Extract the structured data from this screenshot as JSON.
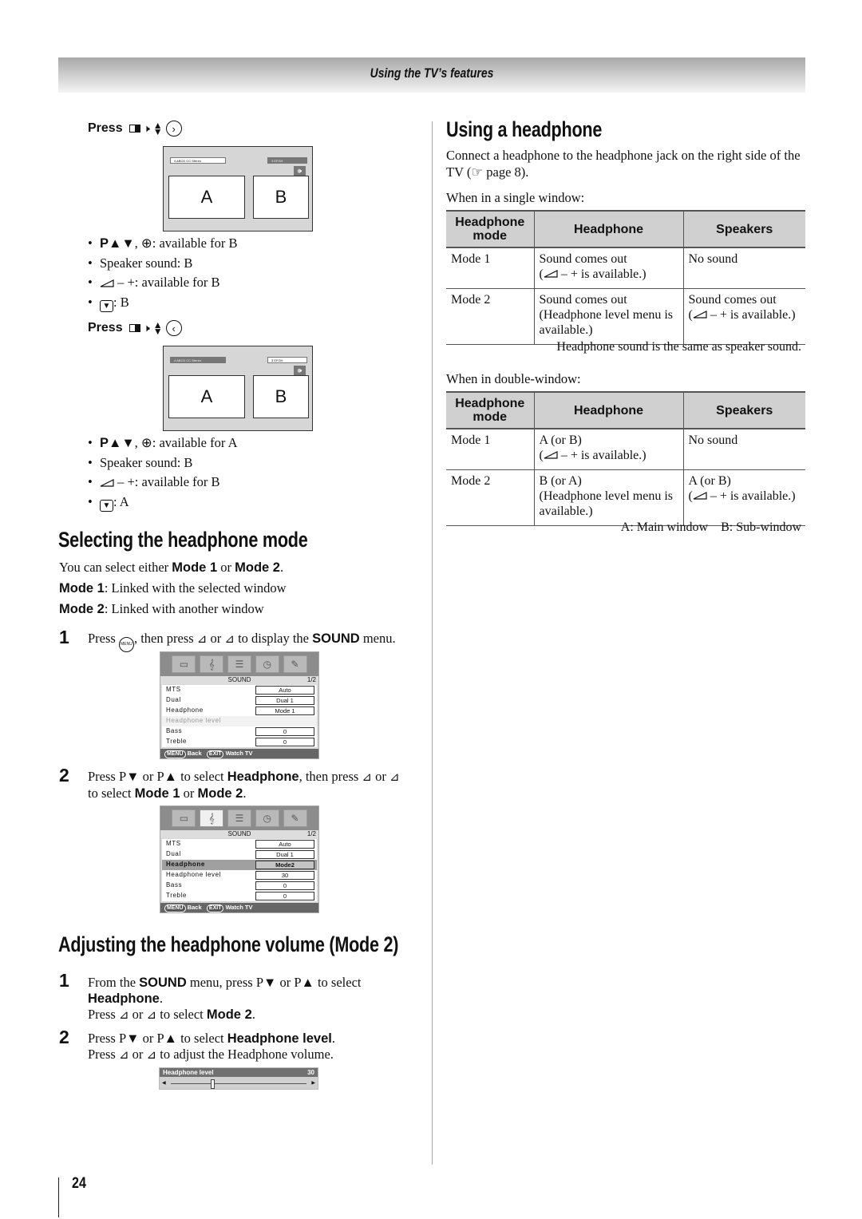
{
  "header": {
    "title": "Using the TV’s features"
  },
  "page_number": "24",
  "left": {
    "press_blocks": [
      {
        "label": "Press",
        "icons": [
          "split-window-icon",
          "speaker-icon",
          "up-down-icon",
          "right-arrow-circle-icon"
        ],
        "arrow_glyph": "›",
        "pip": {
          "main_label": "A",
          "sub_label": "B",
          "main_bar": "4  ABCD   CC Stereo",
          "sub_bar": "3  EFGH",
          "active": "sub"
        },
        "bullets": [
          {
            "bold": "P▲▼",
            "text": ", ⊕: available for B"
          },
          {
            "bold": "",
            "text": "Speaker sound: B"
          },
          {
            "bold": "",
            "text": " – +: available for B"
          },
          {
            "bold": "",
            "text": ": B"
          }
        ]
      },
      {
        "label": "Press",
        "icons": [
          "split-window-icon",
          "speaker-icon",
          "up-down-icon",
          "left-arrow-circle-icon"
        ],
        "arrow_glyph": "‹",
        "pip": {
          "main_label": "A",
          "sub_label": "B",
          "main_bar": "4  ABCD   CC Stereo",
          "sub_bar": "3  EFGH",
          "active": "main"
        },
        "bullets": [
          {
            "bold": "P▲▼",
            "text": ", ⊕: available for A"
          },
          {
            "bold": "",
            "text": "Speaker sound: B"
          },
          {
            "bold": "",
            "text": " – +: available for B"
          },
          {
            "bold": "",
            "text": ": A"
          }
        ]
      }
    ],
    "select_mode": {
      "heading": "Selecting the headphone mode",
      "intro_pre": "You can select either ",
      "intro_b1": "Mode 1",
      "intro_mid": " or ",
      "intro_b2": "Mode 2",
      "intro_post": ".",
      "mode1_label": "Mode 1",
      "mode1_text": ": Linked with the selected window",
      "mode2_label": "Mode 2",
      "mode2_text": ": Linked with another window",
      "steps": [
        {
          "num": "1",
          "pre": "Press ",
          "menu_btn": "MENU",
          "mid": ", then press ",
          "or": " or ",
          "post": " to display the ",
          "bold": "SOUND",
          "end": " menu."
        },
        {
          "num": "2",
          "pre": "Press P▼ or P▲ to select ",
          "bold1": "Headphone",
          "mid": ", then press ",
          "or": " or ",
          "line2_pre": "to select ",
          "bold2": "Mode 1",
          "line2_mid": " or ",
          "bold3": "Mode 2",
          "end": "."
        }
      ],
      "osd1": {
        "title": "SOUND",
        "page": "1/2",
        "rows": [
          {
            "label": "MTS",
            "value": "Auto",
            "state": "normal"
          },
          {
            "label": "Dual",
            "value": "Dual 1",
            "state": "normal"
          },
          {
            "label": "Headphone",
            "value": "Mode 1",
            "state": "normal"
          },
          {
            "label": "Headphone level",
            "value": "",
            "state": "dim"
          },
          {
            "label": "Bass",
            "value": "0",
            "state": "normal"
          },
          {
            "label": "Treble",
            "value": "0",
            "state": "normal"
          }
        ],
        "footer_menu": "MENU",
        "footer_back": "Back",
        "footer_exit": "EXIT",
        "footer_watch": "Watch TV"
      },
      "osd2": {
        "title": "SOUND",
        "page": "1/2",
        "rows": [
          {
            "label": "MTS",
            "value": "Auto",
            "state": "normal"
          },
          {
            "label": "Dual",
            "value": "Dual 1",
            "state": "normal"
          },
          {
            "label": "Headphone",
            "value": "Mode2",
            "state": "highlight"
          },
          {
            "label": "Headphone level",
            "value": "30",
            "state": "normal"
          },
          {
            "label": "Bass",
            "value": "0",
            "state": "normal"
          },
          {
            "label": "Treble",
            "value": "0",
            "state": "normal"
          }
        ],
        "footer_menu": "MENU",
        "footer_back": "Back",
        "footer_exit": "EXIT",
        "footer_watch": "Watch TV"
      }
    },
    "adjust_volume": {
      "heading": "Adjusting the headphone volume (Mode 2)",
      "step1": {
        "num": "1",
        "pre": "From the ",
        "bold1": "SOUND",
        "mid": " menu, press P▼ or P▲ to select",
        "bold2": "Headphone",
        "dot": ".",
        "line3_pre": "Press ",
        "or": " or ",
        "line3_mid": " to select ",
        "bold3": "Mode 2",
        "end": "."
      },
      "step2": {
        "num": "2",
        "pre": "Press P▼ or P▲ to select ",
        "bold1": "Headphone level",
        "dot": ".",
        "line2_pre": "Press ",
        "or": " or ",
        "line2_post": " to adjust the Headphone volume."
      },
      "slider": {
        "label": "Headphone level",
        "value": "30",
        "max": 100
      }
    }
  },
  "right": {
    "heading": "Using a headphone",
    "intro": "Connect a headphone to the headphone jack on the right side of the TV (",
    "intro_ref": "☞",
    "intro_end": " page 8).",
    "single_caption": "When in a single window:",
    "single_table": {
      "headers": [
        "Headphone mode",
        "Headphone",
        "Speakers"
      ],
      "rows": [
        [
          "Mode 1",
          "Sound comes out\n( – + is available.)",
          "No sound"
        ],
        [
          "Mode 2",
          "Sound comes out\n(Headphone level menu is available.)",
          "Sound comes out\n( – + is available.)"
        ]
      ],
      "note": "Headphone sound is the same as speaker sound."
    },
    "double_caption": "When in double-window:",
    "double_table": {
      "headers": [
        "Headphone mode",
        "Headphone",
        "Speakers"
      ],
      "rows": [
        [
          "Mode 1",
          "A (or B)\n( – + is available.)",
          "No sound"
        ],
        [
          "Mode 2",
          "B (or A)\n(Headphone level menu is available.)",
          "A (or B)\n( – + is available.)"
        ]
      ],
      "note": "A: Main window    B: Sub-window"
    }
  }
}
